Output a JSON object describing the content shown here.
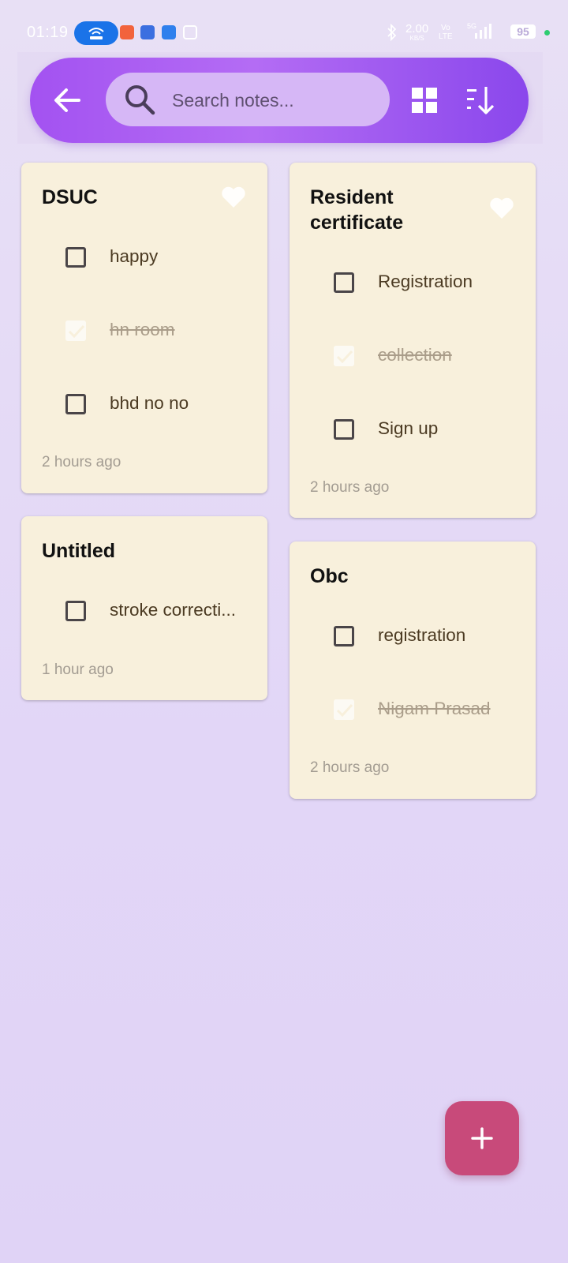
{
  "status_bar": {
    "time": "01:19",
    "net_speed": "2.00",
    "net_unit": "KB/S",
    "volte_top": "Vo",
    "volte_bottom": "LTE",
    "signal_label": "5G",
    "battery": "95"
  },
  "header": {
    "search_placeholder": "Search notes..."
  },
  "notes": [
    {
      "title": "DSUC",
      "favorite": false,
      "items": [
        {
          "text": "happy",
          "checked": false
        },
        {
          "text": "hn room",
          "checked": true
        },
        {
          "text": "bhd no no",
          "checked": false
        }
      ],
      "timestamp": "2 hours ago"
    },
    {
      "title": "Resident certificate",
      "favorite": false,
      "items": [
        {
          "text": "Registration",
          "checked": false
        },
        {
          "text": "collection",
          "checked": true
        },
        {
          "text": "Sign up",
          "checked": false
        }
      ],
      "timestamp": "2 hours ago"
    },
    {
      "title": "Untitled",
      "favorite": false,
      "items": [
        {
          "text": "stroke correcti...",
          "checked": false
        }
      ],
      "timestamp": "1 hour ago"
    },
    {
      "title": "Obc",
      "favorite": false,
      "items": [
        {
          "text": "registration",
          "checked": false
        },
        {
          "text": "Nigam Prasad",
          "checked": true
        }
      ],
      "timestamp": "2 hours ago"
    }
  ],
  "colors": {
    "header_gradient_start": "#a352f1",
    "header_gradient_end": "#8a47ec",
    "card_background": "#f8f0dc",
    "fab": "#c84a7a"
  }
}
